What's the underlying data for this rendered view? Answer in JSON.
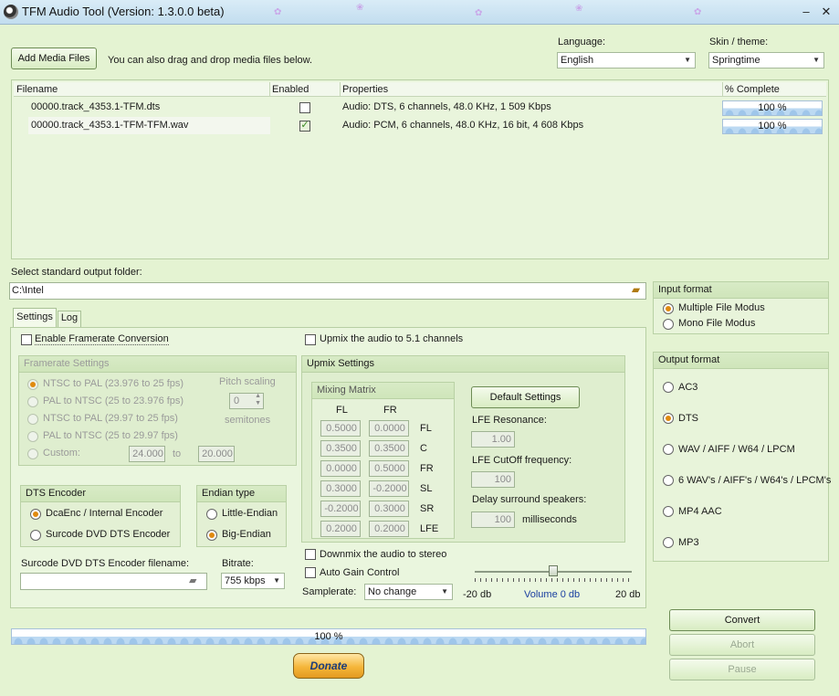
{
  "window": {
    "title": "TFM Audio Tool  (Version: 1.3.0.0 beta)",
    "min_label": "–",
    "close_label": "✕"
  },
  "top": {
    "add_media_label": "Add Media Files",
    "drag_hint": "You can also drag and drop media files below.",
    "language_label": "Language:",
    "language_value": "English",
    "skin_label": "Skin / theme:",
    "skin_value": "Springtime"
  },
  "filelist": {
    "headers": [
      "Filename",
      "Enabled",
      "Properties",
      "% Complete"
    ],
    "rows": [
      {
        "filename": "00000.track_4353.1-TFM.dts",
        "enabled": false,
        "properties": "Audio: DTS, 6 channels, 48.0 KHz, 1 509 Kbps",
        "progress_text": "100 %",
        "progress": 1.0
      },
      {
        "filename": "00000.track_4353.1-TFM-TFM.wav",
        "enabled": true,
        "properties": "Audio: PCM, 6 channels, 48.0 KHz, 16 bit, 4 608 Kbps",
        "progress_text": "100 %",
        "progress": 1.0
      }
    ]
  },
  "output_folder": {
    "label": "Select standard output folder:",
    "value": "C:\\Intel"
  },
  "tabs": [
    "Settings",
    "Log"
  ],
  "settings": {
    "enable_framerate": "Enable Framerate Conversion",
    "upmix_check": "Upmix the audio to 5.1 channels",
    "framerate_group": "Framerate Settings",
    "framerate_options": [
      "NTSC to PAL (23.976 to 25 fps)",
      "PAL to NTSC (25 to 23.976 fps)",
      "NTSC to PAL (29.97 to 25 fps)",
      "PAL to NTSC (25 to 29.97 fps)",
      "Custom:"
    ],
    "custom_from": "24.000",
    "custom_to_label": "to",
    "custom_to": "20.000",
    "pitch_label": "Pitch scaling",
    "pitch_value": "0",
    "semitones_label": "semitones",
    "upmix_group": "Upmix Settings",
    "mixing_matrix": "Mixing Matrix",
    "matrix_cols": [
      "FL",
      "FR"
    ],
    "matrix_rows": [
      {
        "fl": "0.5000",
        "fr": "0.0000",
        "ch": "FL"
      },
      {
        "fl": "0.3500",
        "fr": "0.3500",
        "ch": "C"
      },
      {
        "fl": "0.0000",
        "fr": "0.5000",
        "ch": "FR"
      },
      {
        "fl": "0.3000",
        "fr": "-0.2000",
        "ch": "SL"
      },
      {
        "fl": "-0.2000",
        "fr": "0.3000",
        "ch": "SR"
      },
      {
        "fl": "0.2000",
        "fr": "0.2000",
        "ch": "LFE"
      }
    ],
    "default_settings": "Default Settings",
    "lfe_resonance_label": "LFE Resonance:",
    "lfe_resonance": "1.00",
    "lfe_cutoff_label": "LFE CutOff frequency:",
    "lfe_cutoff": "100",
    "delay_label": "Delay surround speakers:",
    "delay_value": "100",
    "delay_unit": "milliseconds",
    "dts_group": "DTS Encoder",
    "dts_options": [
      "DcaEnc / Internal Encoder",
      "Surcode DVD DTS Encoder"
    ],
    "endian_group": "Endian type",
    "endian_options": [
      "Little-Endian",
      "Big-Endian"
    ],
    "surcode_label": "Surcode DVD DTS Encoder filename:",
    "bitrate_label": "Bitrate:",
    "bitrate_value": "755 kbps",
    "downmix": "Downmix the audio to stereo",
    "agc": "Auto Gain Control",
    "samplerate_label": "Samplerate:",
    "samplerate_value": "No change",
    "vol_min": "-20 db",
    "vol_label": "Volume 0 db",
    "vol_max": "20 db",
    "volume_db": 0
  },
  "input_format": {
    "title": "Input format",
    "options": [
      "Multiple File Modus",
      "Mono File Modus"
    ],
    "selected": 0
  },
  "output_format": {
    "title": "Output format",
    "options": [
      "AC3",
      "DTS",
      "WAV / AIFF / W64 / LPCM",
      "6 WAV's / AIFF's / W64's / LPCM's",
      "MP4 AAC",
      "MP3"
    ],
    "selected": 1
  },
  "overall_progress": {
    "text": "100 %",
    "value": 1.0
  },
  "actions": {
    "convert": "Convert",
    "abort": "Abort",
    "pause": "Pause",
    "donate": "Donate"
  },
  "colors": {
    "background": "#e4f3d2",
    "accent_radio": "#e08a10",
    "donate": "#f5b63a"
  },
  "icons": {
    "folder": "folder-icon",
    "checkmark": "checkmark-icon"
  }
}
